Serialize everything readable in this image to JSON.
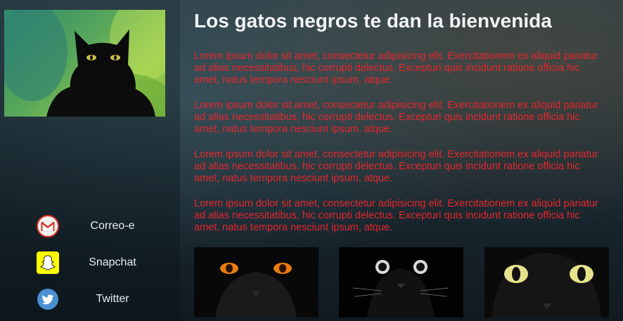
{
  "header": {
    "title": "Los gatos negros te dan la bienvenida"
  },
  "paragraphs": [
    "Lorem ipsum dolor sit amet, consectetur adipisicing elit. Exercitationem ex aliquid pariatur ad alias necessitatibus, hic corrupti delectus. Excepturi quis incidunt ratione officia hic amet, natus tempora nesciunt ipsum, atque.",
    "Lorem ipsum dolor sit amet, consectetur adipisicing elit. Exercitationem ex aliquid pariatur ad alias necessitatibus, hic corrupti delectus. Excepturi quis incidunt ratione officia hic amet, natus tempora nesciunt ipsum, atque.",
    "Lorem ipsum dolor sit amet, consectetur adipisicing elit. Exercitationem ex aliquid pariatur ad alias necessitatibus, hic corrupti delectus. Excepturi quis incidunt ratione officia hic amet, natus tempora nesciunt ipsum, atque.",
    "Lorem ipsum dolor sit amet, consectetur adipisicing elit. Exercitationem ex aliquid pariatur ad alias necessitatibus, hic corrupti delectus. Excepturi quis incidunt ratione officia hic amet, natus tempora nesciunt ipsum, atque."
  ],
  "sidebar": {
    "hero_image": "black-cat-photo",
    "social": [
      {
        "label": "Correo-e",
        "icon": "gmail-icon"
      },
      {
        "label": "Snapchat",
        "icon": "snapchat-icon"
      },
      {
        "label": "Twitter",
        "icon": "twitter-icon"
      }
    ]
  },
  "gallery": [
    {
      "image": "cat-orange-eyes-photo"
    },
    {
      "image": "cat-white-eyes-photo"
    },
    {
      "image": "cat-yellow-eyes-photo"
    }
  ],
  "colors": {
    "title": "#f2f4f5",
    "paragraph_text": "#e5262d",
    "gmail_red": "#d93025",
    "snapchat_yellow": "#fffc00",
    "twitter_blue": "#1da1f2"
  }
}
